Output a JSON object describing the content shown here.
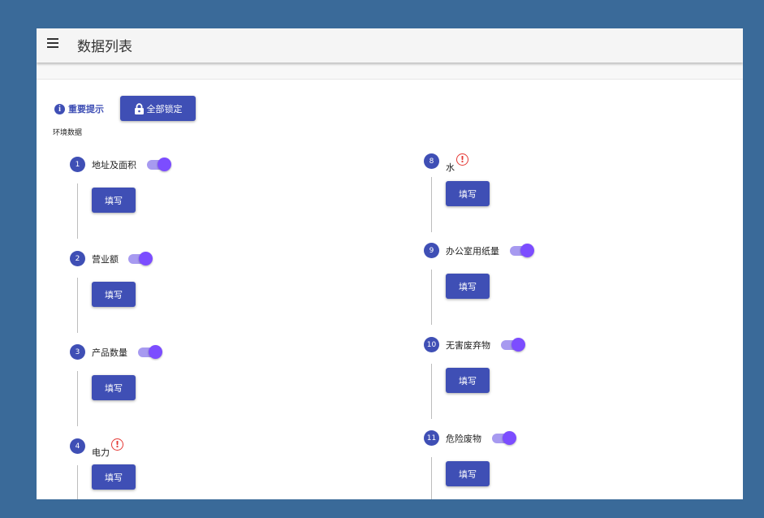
{
  "appbar": {
    "title": "数据列表"
  },
  "toolbar": {
    "notice_label": "重要提示",
    "info_glyph": "i",
    "lock_all_label": "全部锁定"
  },
  "section": {
    "title": "环境数据"
  },
  "fill_label": "填写",
  "alert_glyph": "!",
  "colors": {
    "primary": "#3f4fb5",
    "toggle_thumb": "#7c4dff",
    "toggle_track": "#a79af0",
    "alert": "#e53935",
    "background": "#3a6a99"
  },
  "steps": [
    {
      "number": "1",
      "label": "地址及面积",
      "toggle_on": true
    },
    {
      "number": "2",
      "label": "营业额",
      "toggle_on": true
    },
    {
      "number": "3",
      "label": "产品数量",
      "toggle_on": true
    },
    {
      "number": "4",
      "label": "电力",
      "alert": true
    },
    {
      "number": "8",
      "label": "水",
      "alert": true
    },
    {
      "number": "9",
      "label": "办公室用纸量",
      "toggle_on": true
    },
    {
      "number": "10",
      "label": "无害废弃物",
      "toggle_on": true
    },
    {
      "number": "11",
      "label": "危险废物",
      "toggle_on": true
    }
  ]
}
